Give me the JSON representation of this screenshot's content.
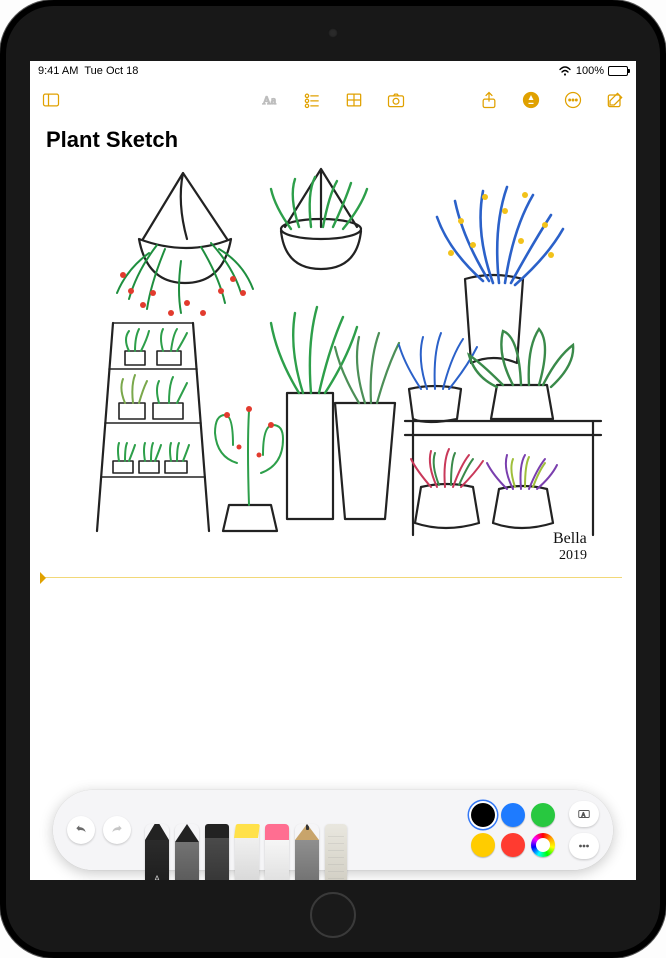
{
  "status": {
    "time": "9:41 AM",
    "date": "Tue Oct 18",
    "battery_text": "100%",
    "wifi_symbol": "▶"
  },
  "toolbar": {
    "sidebar_icon": "sidebar",
    "format_icon": "Aa",
    "checklist_icon": "checklist",
    "table_icon": "table",
    "camera_icon": "camera",
    "share_icon": "share",
    "lock_icon": "lock",
    "more_icon": "ellipsis",
    "compose_icon": "compose"
  },
  "note": {
    "title": "Plant Sketch",
    "signature_name": "Bella",
    "signature_year": "2019"
  },
  "palette": {
    "undo": "undo",
    "redo": "redo",
    "tools": [
      {
        "kind": "pen",
        "label": "A"
      },
      {
        "kind": "pen2",
        "label": ""
      },
      {
        "kind": "marker",
        "label": ""
      },
      {
        "kind": "highlighter",
        "label": ""
      },
      {
        "kind": "eraser",
        "label": ""
      },
      {
        "kind": "pencil",
        "label": ""
      },
      {
        "kind": "ruler",
        "label": ""
      }
    ],
    "colors": [
      {
        "hex": "#000000",
        "selected": true
      },
      {
        "hex": "#1e7bff",
        "selected": false
      },
      {
        "hex": "#28c840",
        "selected": false
      },
      {
        "hex": "#ffcc00",
        "selected": false
      },
      {
        "hex": "#ff3b30",
        "selected": false
      },
      {
        "hex": "rainbow",
        "selected": false
      }
    ],
    "text_tool_icon": "text-field",
    "more_icon": "more"
  }
}
